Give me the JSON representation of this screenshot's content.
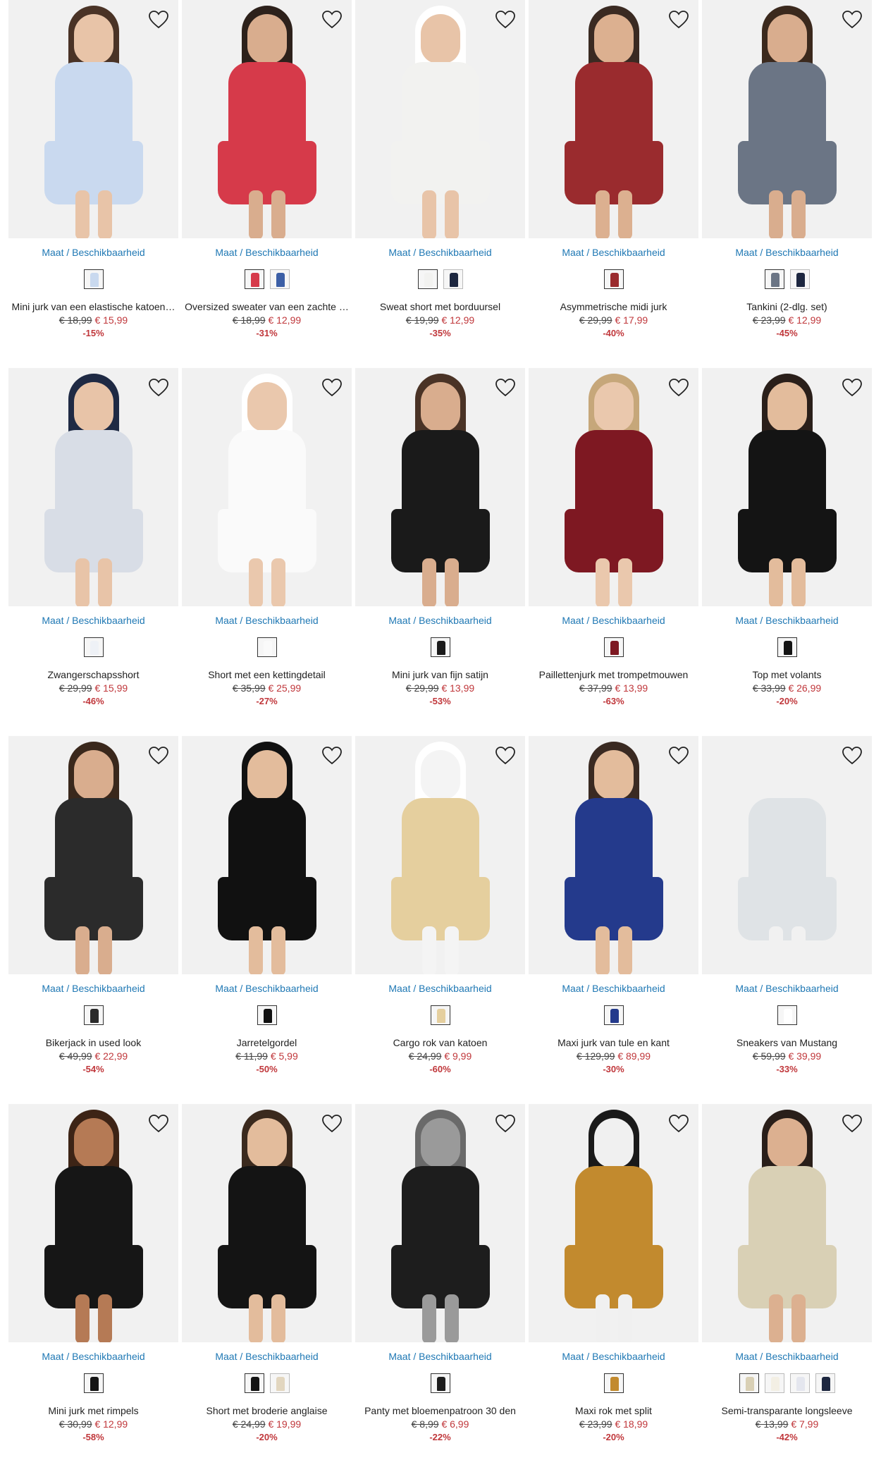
{
  "size_link_label": "Maat / Beschikbaarheid",
  "products": [
    {
      "name": "Mini jurk van een elastische katoen…",
      "old_price": "€ 18,99",
      "new_price": "€ 15,99",
      "discount": "-15%",
      "image_color": "#c9d9ef",
      "skin": "#e8c4a8",
      "hair": "#4a3326",
      "swatches": [
        "#c9d9ef"
      ]
    },
    {
      "name": "Oversized sweater van een zachte …",
      "old_price": "€ 18,99",
      "new_price": "€ 12,99",
      "discount": "-31%",
      "image_color": "#d63a4a",
      "skin": "#d9ad8e",
      "hair": "#2d211b",
      "swatches": [
        "#d63a4a",
        "#3c5fa6"
      ]
    },
    {
      "name": "Sweat short met borduursel",
      "old_price": "€ 19,99",
      "new_price": "€ 12,99",
      "discount": "-35%",
      "image_color": "#f2f2f0",
      "skin": "#e8c4a8",
      "hair": "#ffffff",
      "swatches": [
        "#f2f2f0",
        "#1d2740"
      ]
    },
    {
      "name": "Asymmetrische midi jurk",
      "old_price": "€ 29,99",
      "new_price": "€ 17,99",
      "discount": "-40%",
      "image_color": "#9a2b2e",
      "skin": "#dcb090",
      "hair": "#3a2a22",
      "swatches": [
        "#9a2b2e"
      ]
    },
    {
      "name": "Tankini (2-dlg. set)",
      "old_price": "€ 23,99",
      "new_price": "€ 12,99",
      "discount": "-45%",
      "image_color": "#6b7585",
      "skin": "#d9ad8e",
      "hair": "#3b291d",
      "swatches": [
        "#6b7585",
        "#1d2740"
      ]
    },
    {
      "name": "Zwangerschapsshort",
      "old_price": "€ 29,99",
      "new_price": "€ 15,99",
      "discount": "-46%",
      "image_color": "#d8dde6",
      "skin": "#e8c4a8",
      "hair": "#1f2a44",
      "swatches": [
        "#eef1f6"
      ]
    },
    {
      "name": "Short met een kettingdetail",
      "old_price": "€ 35,99",
      "new_price": "€ 25,99",
      "discount": "-27%",
      "image_color": "#fafafa",
      "skin": "#eac8ad",
      "hair": "#ffffff",
      "swatches": [
        "#fafafa"
      ]
    },
    {
      "name": "Mini jurk van fijn satijn",
      "old_price": "€ 29,99",
      "new_price": "€ 13,99",
      "discount": "-53%",
      "image_color": "#1a1a1a",
      "skin": "#d9ad8e",
      "hair": "#4a3326",
      "swatches": [
        "#1a1a1a"
      ]
    },
    {
      "name": "Paillettenjurk met trompetmouwen",
      "old_price": "€ 37,99",
      "new_price": "€ 13,99",
      "discount": "-63%",
      "image_color": "#7e1822",
      "skin": "#eac8ad",
      "hair": "#c6a77a",
      "swatches": [
        "#7e1822"
      ]
    },
    {
      "name": "Top met volants",
      "old_price": "€ 33,99",
      "new_price": "€ 26,99",
      "discount": "-20%",
      "image_color": "#141414",
      "skin": "#e3bc9c",
      "hair": "#2a1f1a",
      "swatches": [
        "#141414"
      ]
    },
    {
      "name": "Bikerjack in used look",
      "old_price": "€ 49,99",
      "new_price": "€ 22,99",
      "discount": "-54%",
      "image_color": "#2b2b2b",
      "skin": "#d9ad8e",
      "hair": "#3a281c",
      "swatches": [
        "#2b2b2b"
      ]
    },
    {
      "name": "Jarretelgordel",
      "old_price": "€ 11,99",
      "new_price": "€ 5,99",
      "discount": "-50%",
      "image_color": "#111111",
      "skin": "#e3bc9c",
      "hair": "#111111",
      "swatches": [
        "#111111"
      ]
    },
    {
      "name": "Cargo rok van katoen",
      "old_price": "€ 24,99",
      "new_price": "€ 9,99",
      "discount": "-60%",
      "image_color": "#e5cf9e",
      "skin": "#f4f4f4",
      "hair": "#ffffff",
      "swatches": [
        "#e5cf9e"
      ]
    },
    {
      "name": "Maxi jurk van tule en kant",
      "old_price": "€ 129,99",
      "new_price": "€ 89,99",
      "discount": "-30%",
      "image_color": "#243a8c",
      "skin": "#e3bc9c",
      "hair": "#3a2a22",
      "swatches": [
        "#243a8c"
      ]
    },
    {
      "name": "Sneakers van Mustang",
      "old_price": "€ 59,99",
      "new_price": "€ 39,99",
      "discount": "-33%",
      "image_color": "#dfe3e6",
      "skin": "#f1f1f1",
      "hair": "#f1f1f1",
      "swatches": [
        "#ffffff"
      ]
    },
    {
      "name": "Mini jurk met rimpels",
      "old_price": "€ 30,99",
      "new_price": "€ 12,99",
      "discount": "-58%",
      "image_color": "#161616",
      "skin": "#b57a55",
      "hair": "#3d2416",
      "swatches": [
        "#161616"
      ]
    },
    {
      "name": "Short met broderie anglaise",
      "old_price": "€ 24,99",
      "new_price": "€ 19,99",
      "discount": "-20%",
      "image_color": "#141414",
      "skin": "#e3bc9c",
      "hair": "#3b2a1e",
      "swatches": [
        "#141414",
        "#e2d6bf"
      ]
    },
    {
      "name": "Panty met bloemenpatroon 30 den",
      "old_price": "€ 8,99",
      "new_price": "€ 6,99",
      "discount": "-22%",
      "image_color": "#1d1d1d",
      "skin": "#9a9a9a",
      "hair": "#6a6a6a",
      "swatches": [
        "#1d1d1d"
      ]
    },
    {
      "name": "Maxi rok met split",
      "old_price": "€ 23,99",
      "new_price": "€ 18,99",
      "discount": "-20%",
      "image_color": "#c28a2e",
      "skin": "#f0f0f0",
      "hair": "#1a1a1a",
      "swatches": [
        "#c28a2e"
      ]
    },
    {
      "name": "Semi-transparante longsleeve",
      "old_price": "€ 13,99",
      "new_price": "€ 7,99",
      "discount": "-42%",
      "image_color": "#d9d0b5",
      "skin": "#dcb090",
      "hair": "#2a1f1a",
      "swatches": [
        "#d9d0b5",
        "#f3efe4",
        "#e4e6ee",
        "#1d2740"
      ]
    }
  ]
}
